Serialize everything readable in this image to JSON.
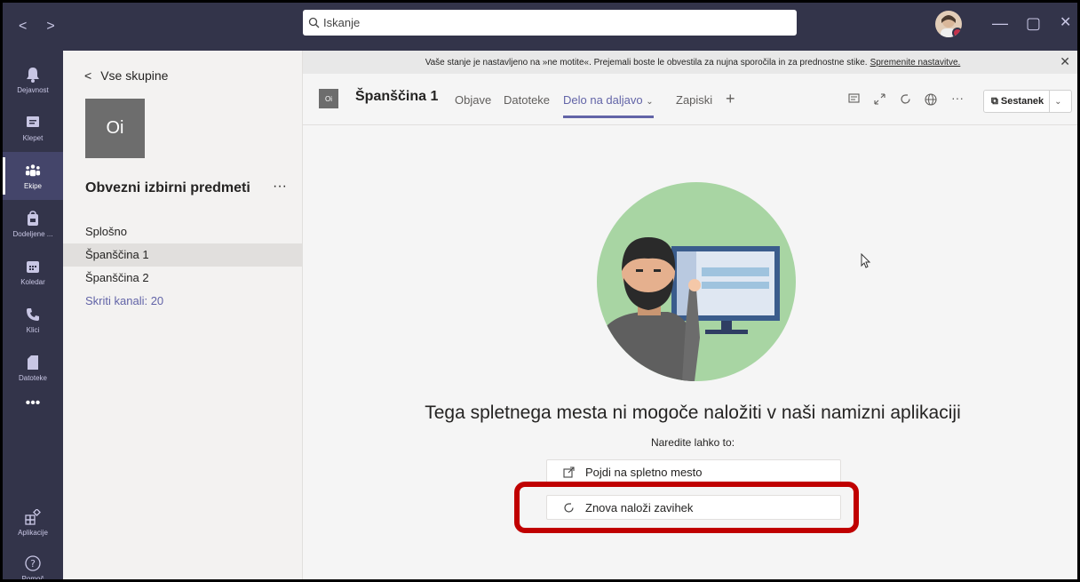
{
  "titlebar": {
    "back_arrow": "<",
    "forward_arrow": ">",
    "search_placeholder": "Iskanje",
    "minimize": "—",
    "maximize": "▢",
    "close": "✕"
  },
  "rail": {
    "items": [
      {
        "label": "Dejavnost",
        "icon": "bell-icon"
      },
      {
        "label": "Klepet",
        "icon": "chat-icon"
      },
      {
        "label": "Ekipe",
        "icon": "teams-icon",
        "active": true
      },
      {
        "label": "Dodeljene ...",
        "icon": "assignments-icon"
      },
      {
        "label": "Koledar",
        "icon": "calendar-icon"
      },
      {
        "label": "Klici",
        "icon": "phone-icon"
      },
      {
        "label": "Datoteke",
        "icon": "file-icon"
      },
      {
        "label": "•••",
        "icon": "more-icon"
      }
    ],
    "bottom": [
      {
        "label": "Aplikacije",
        "icon": "apps-icon"
      },
      {
        "label": "Pomoč",
        "icon": "help-icon"
      }
    ]
  },
  "channel_pane": {
    "back_label": "Vse skupine",
    "team_initials": "Oi",
    "team_name": "Obvezni izbirni predmeti",
    "team_more": "···",
    "channels": [
      {
        "label": "Splošno"
      },
      {
        "label": "Španščina 1",
        "selected": true
      },
      {
        "label": "Španščina 2"
      }
    ],
    "hidden_channels": "Skriti kanali: 20"
  },
  "banner": {
    "text": "Vaše stanje je nastavljeno na »ne motite«. Prejemali boste le obvestila za nujna sporočila in za prednostne stike.",
    "link": "Spremenite nastavitve."
  },
  "channel_header": {
    "tile_initials": "Oi",
    "title": "Španščina 1",
    "tabs": [
      {
        "label": "Objave"
      },
      {
        "label": "Datoteke"
      },
      {
        "label": "Delo na daljavo",
        "active": true
      }
    ],
    "tab_notes": "Zapiski",
    "add_tab": "+",
    "meeting_label": "Sestanek"
  },
  "content": {
    "message": "Tega spletnega mesta ni mogoče naložiti v naši namizni aplikaciji",
    "sub": "Naredite lahko to:",
    "go_to_site": "Pojdi na spletno mesto",
    "reload_tab": "Znova naloži zavihek"
  },
  "colors": {
    "rail": "#33344a",
    "accent": "#6264a7",
    "highlight": "#c00000",
    "illustration_bg": "#a8d5a3"
  }
}
